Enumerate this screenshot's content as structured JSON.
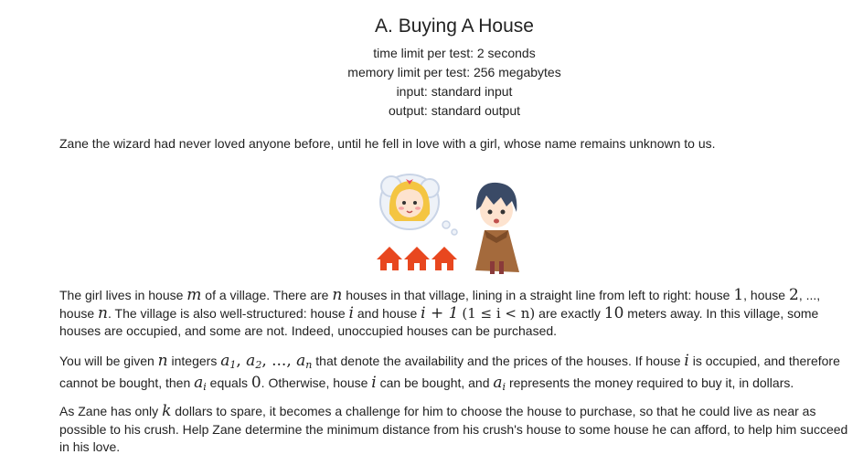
{
  "problem": {
    "title": "A. Buying A House",
    "time_limit": "time limit per test: 2 seconds",
    "memory_limit": "memory limit per test: 256 megabytes",
    "input": "input: standard input",
    "output": "output: standard output"
  },
  "statement": {
    "intro": "Zane the wizard had never loved anyone before, until he fell in love with a girl, whose name remains unknown to us.",
    "p1": {
      "a": "The girl lives in house ",
      "m": "m",
      "b": " of a village. There are ",
      "n": "n",
      "c": " houses in that village, lining in a straight line from left to right: house ",
      "one": "1",
      "d": ", house ",
      "two": "2",
      "e": ", ...,",
      "f": "house ",
      "n2": "n",
      "g": ". The village is also well-structured: house ",
      "i": "i",
      "h": " and house ",
      "i1": "i + 1",
      "cond": "(1 ≤ i < n)",
      "j": " are exactly ",
      "ten": "10",
      "k": " meters away. In this village, some houses are occupied, and some are not. Indeed, unoccupied houses can be purchased."
    },
    "p2": {
      "a": "You will be given ",
      "n": "n",
      "b": " integers ",
      "seq": "a",
      "s1": "1",
      "comma1": ", ",
      "s2": "2",
      "dots": ", ..., ",
      "sn": "n",
      "c": " that denote the availability and the prices of the houses. If house ",
      "i": "i",
      "d": " is occupied, and therefore cannot be bought, then ",
      "ai": "i",
      "e": " equals ",
      "zero": "0",
      "f": ". Otherwise, house ",
      "i2": "i",
      "g": " can be bought, and ",
      "ai2": "i",
      "h": " represents the money required to buy it, in dollars."
    },
    "p3": {
      "a": "As Zane has only ",
      "k": "k",
      "b": " dollars to spare, it becomes a challenge for him to choose the house to purchase, so that he could live as near as possible to his crush. Help Zane determine the minimum distance from his crush's house to some house he can afford, to help him succeed in his love."
    }
  },
  "illustration": {
    "icon": "wizard-and-girl-houses-illustration",
    "colors": {
      "house": "#e8471f",
      "hair_girl": "#f4c542",
      "hair_boy": "#3a4a66",
      "cloak": "#a46a3c",
      "thought": "#c9d4e6"
    }
  }
}
